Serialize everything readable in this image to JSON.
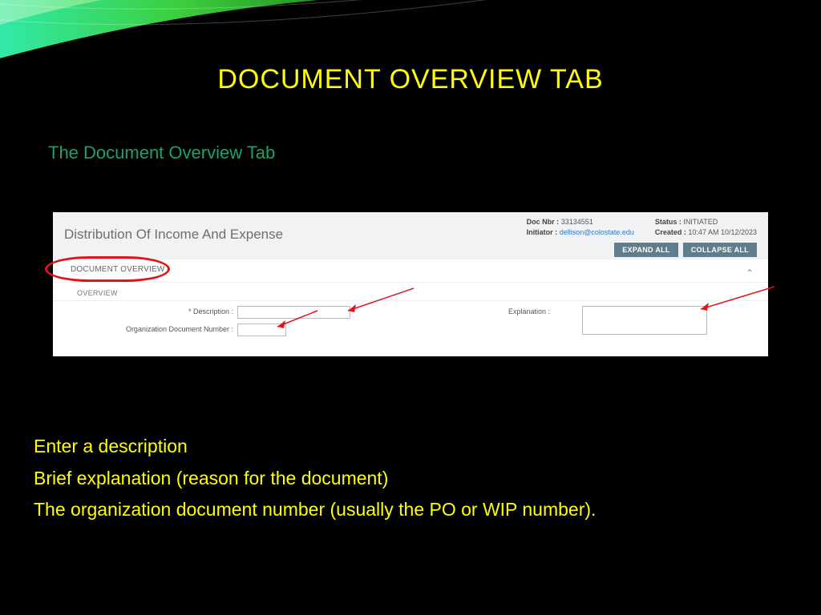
{
  "slide": {
    "title": "DOCUMENT OVERVIEW TAB",
    "subtitle": "The Document Overview Tab"
  },
  "panel": {
    "title": "Distribution Of Income And Expense",
    "meta": {
      "doc_nbr_label": "Doc Nbr :",
      "doc_nbr": "33134551",
      "initiator_label": "Initiator :",
      "initiator": "dellison@colostate.edu",
      "status_label": "Status :",
      "status": "INITIATED",
      "created_label": "Created :",
      "created": "10:47 AM 10/12/2023"
    },
    "buttons": {
      "expand": "EXPAND ALL",
      "collapse": "COLLAPSE ALL"
    },
    "section_tab": "DOCUMENT OVERVIEW",
    "overview_header": "OVERVIEW",
    "fields": {
      "description_label": "* Description :",
      "org_doc_label": "Organization Document Number :",
      "explanation_label": "Explanation :"
    }
  },
  "bullets": {
    "b1": "Enter a description",
    "b2": "Brief explanation (reason for the document)",
    "b3": "The organization document number (usually the PO or WIP number)."
  }
}
